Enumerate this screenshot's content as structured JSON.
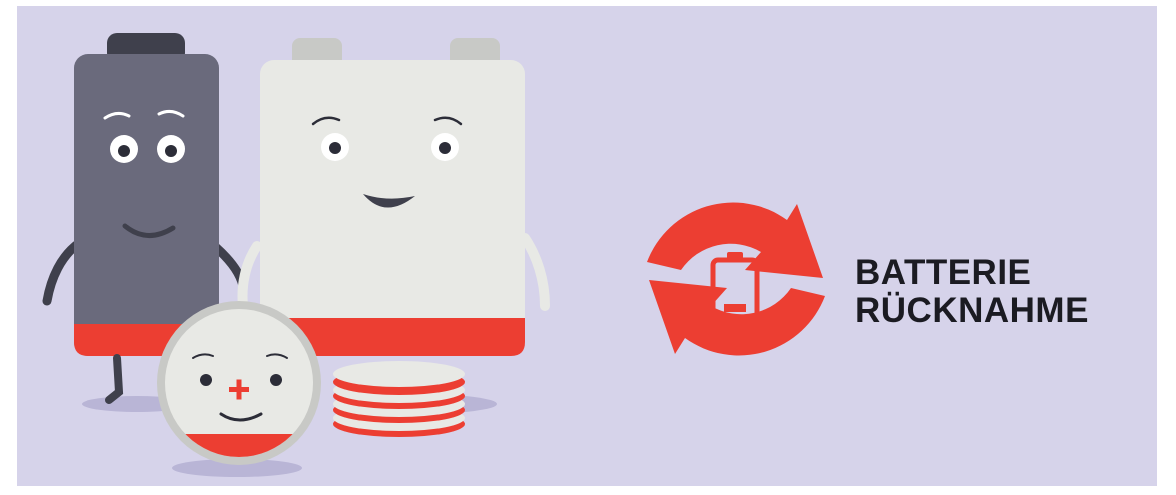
{
  "colors": {
    "background": "#d6d3ea",
    "brand_red": "#ec3e32",
    "dark_battery": "#6a6a7c",
    "light_battery": "#e8e9e5",
    "text": "#1b1b22"
  },
  "icons": [
    "recycle-arrows-icon",
    "battery-low-icon"
  ],
  "title": {
    "line1": "BATTERIE",
    "line2": "RÜCKNAHME"
  }
}
